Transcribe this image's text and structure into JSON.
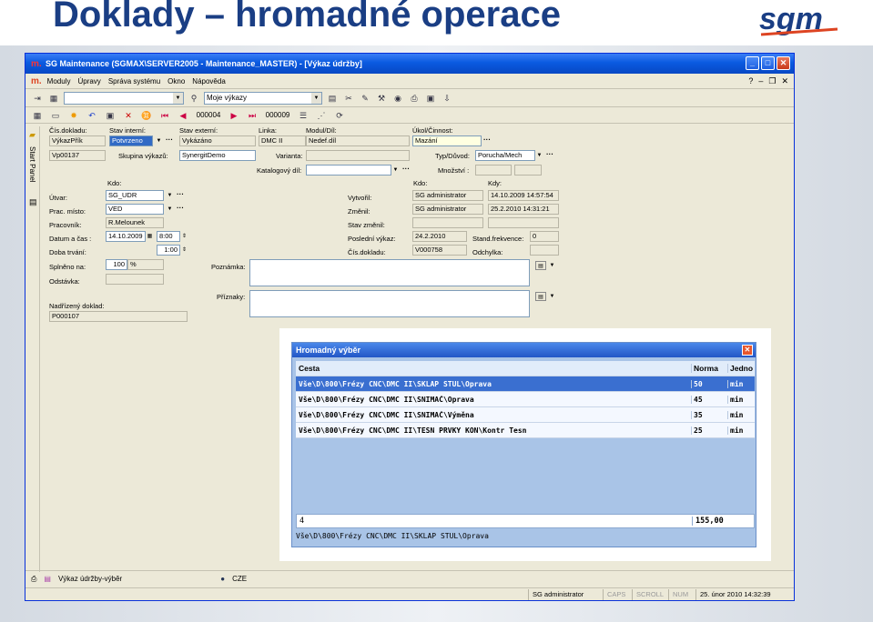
{
  "slide": {
    "title": "Doklady – hromadné operace"
  },
  "window": {
    "title": "SG Maintenance (SGMAX\\SERVER2005 - Maintenance_MASTER) - [Výkaz údržby]",
    "app_icon": "m."
  },
  "menu": {
    "items": [
      "Moduly",
      "Úpravy",
      "Správa systému",
      "Okno",
      "Nápověda"
    ]
  },
  "toolbar": {
    "filter_value": "Moje výkazy"
  },
  "navbar": {
    "current": "000004",
    "total": "000009"
  },
  "left_panel": {
    "label": "Start Panel"
  },
  "form": {
    "cis_dokladu_lbl": "Čís.dokladu:",
    "cis_dokladu": "VýkazPřík",
    "cis_num": "Vp00137",
    "stav_int_lbl": "Stav interní:",
    "stav_int": "Potvrzeno",
    "stav_ext_lbl": "Stav externí:",
    "stav_ext": "Vykázáno",
    "skupina_lbl": "Skupina výkazů:",
    "skupina": "SynergitDemo",
    "linka_lbl": "Linka:",
    "linka": "DMC II",
    "modul_lbl": "Modul/Díl:",
    "modul": "Nedef.díl",
    "varianta_lbl": "Varianta:",
    "katalog_lbl": "Katalogový díl:",
    "ukol_lbl": "Úkol/Činnost:",
    "ukol": "Mazání",
    "typ_lbl": "Typ/Důvod:",
    "typ": "Porucha/Mech",
    "mnozstvi_lbl": "Množství :",
    "kdo_lbl": "Kdo:",
    "kdo2_lbl": "Kdo:",
    "kdy_lbl": "Kdy:",
    "utvar_lbl": "Útvar:",
    "utvar": "SG_UDR",
    "prac_misto_lbl": "Prac. místo:",
    "prac_misto": "VED",
    "pracovnik_lbl": "Pracovník:",
    "pracovnik": "R.Melounek",
    "datum_lbl": "Datum a čas :",
    "datum": "14.10.2009",
    "cas": "8:00",
    "doba_lbl": "Doba trvání:",
    "doba": "1:00",
    "splneno_lbl": "Splněno na:",
    "splneno": "100",
    "splneno_unit": "%",
    "odstavka_lbl": "Odstávka:",
    "nadrizeny_lbl": "Nadřízený doklad:",
    "nadrizeny": "P000107",
    "poznamka_lbl": "Poznámka:",
    "priznaky_lbl": "Příznaky:",
    "vytvoril_lbl": "Vytvořil:",
    "vytvoril": "SG administrator",
    "vytvoril_kdy": "14.10.2009 14:57:54",
    "zmenil_lbl": "Změnil:",
    "zmenil": "SG administrator",
    "zmenil_kdy": "25.2.2010 14:31:21",
    "stav_zmenil_lbl": "Stav změnil:",
    "posledni_lbl": "Poslední výkaz:",
    "posledni": "24.2.2010",
    "stand_lbl": "Stand.frekvence:",
    "stand": "0",
    "cis_dokladu2_lbl": "Čís.dokladu:",
    "cis_dokladu2": "V000758",
    "odchylka_lbl": "Odchylka:"
  },
  "popup": {
    "title": "Hromadný výběr",
    "headers": [
      "Cesta",
      "Norma",
      "Jedno"
    ],
    "rows": [
      [
        "Vše\\D\\800\\Frézy CNC\\DMC II\\SKLAP STUL\\Oprava",
        "50",
        "min"
      ],
      [
        "Vše\\D\\800\\Frézy CNC\\DMC II\\SNIMAČ\\Oprava",
        "45",
        "min"
      ],
      [
        "Vše\\D\\800\\Frézy CNC\\DMC II\\SNIMAČ\\Výměna",
        "35",
        "min"
      ],
      [
        "Vše\\D\\800\\Frézy CNC\\DMC II\\TESN PRVKY KON\\Kontr Tesn",
        "25",
        "min"
      ]
    ],
    "footer_count": "4",
    "footer_sum": "155,00",
    "path": "Vše\\D\\800\\Frézy CNC\\DMC II\\SKLAP STUL\\Oprava"
  },
  "taskbar": {
    "tab": "Výkaz údržby-výběr",
    "lang": "CZE"
  },
  "status": {
    "user": "SG administrator",
    "caps": "CAPS",
    "scroll": "SCROLL",
    "num": "NUM",
    "datetime": "25. únor 2010 14:32:39"
  }
}
